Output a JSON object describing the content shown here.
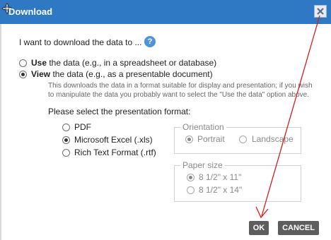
{
  "dialog": {
    "title": "Download",
    "close_label": "×"
  },
  "intro": "I want to download the data to ...",
  "help_icon": "?",
  "use_option": {
    "bold": "Use",
    "rest": " the data (e.g., in a spreadsheet or database)",
    "selected": false
  },
  "view_option": {
    "bold": "View",
    "rest": " the data (e.g., as a presentable document)",
    "selected": true
  },
  "view_description": "This downloads the data in a format suitable for display and presentation; if you wish to manipulate the data you probably want to select the \"Use the data\" option above.",
  "format_label": "Please select the presentation format:",
  "formats": [
    {
      "label": "PDF",
      "selected": false
    },
    {
      "label": "Microsoft Excel (.xls)",
      "selected": true
    },
    {
      "label": "Rich Text Format (.rtf)",
      "selected": false
    }
  ],
  "orientation": {
    "legend": "Orientation",
    "portrait": "Portrait",
    "landscape": "Landscape",
    "selected": "Portrait"
  },
  "paper": {
    "legend": "Paper size",
    "letter": "8 1/2\" x 11\"",
    "legal": "8 1/2\" x 14\"",
    "selected": "letter"
  },
  "buttons": {
    "ok": "OK",
    "cancel": "CANCEL"
  },
  "colors": {
    "title_bar": "#2f78c4",
    "button": "#5d5d5d",
    "annotation_arrow": "#e0191b"
  }
}
